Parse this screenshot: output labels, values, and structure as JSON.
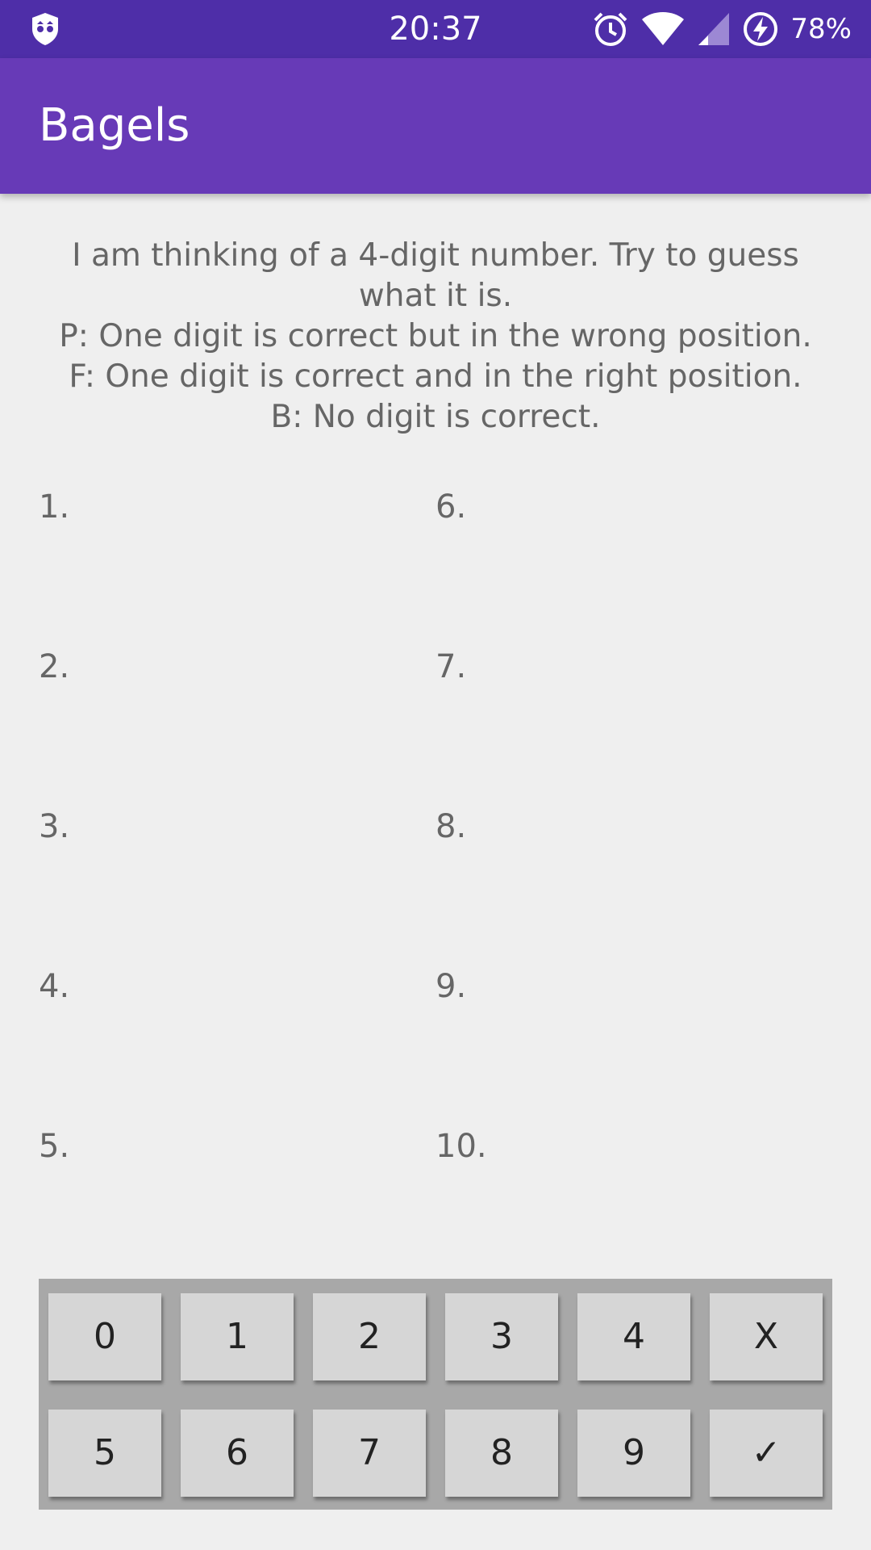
{
  "status_bar": {
    "time": "20:37",
    "battery": "78%",
    "icons": [
      "incognito-shield-icon",
      "alarm-icon",
      "wifi-icon",
      "cell-signal-icon",
      "battery-charging-icon"
    ]
  },
  "app_bar": {
    "title": "Bagels"
  },
  "instructions": {
    "intro": "I am thinking of a 4-digit number. Try to guess what it is.",
    "p_rule": "P: One digit is correct but in the wrong position.",
    "f_rule": "F: One digit is correct and in the right position.",
    "b_rule": "B: No digit is correct."
  },
  "guesses": [
    "1.",
    "2.",
    "3.",
    "4.",
    "5.",
    "6.",
    "7.",
    "8.",
    "9.",
    "10."
  ],
  "keypad": {
    "row1": [
      "0",
      "1",
      "2",
      "3",
      "4",
      "X"
    ],
    "row2": [
      "5",
      "6",
      "7",
      "8",
      "9",
      "✓"
    ]
  },
  "colors": {
    "status_bar": "#4e2ea8",
    "app_bar": "#673ab7",
    "background": "#efefef",
    "keypad_frame": "#a8a8a8",
    "key": "#d6d6d6"
  }
}
